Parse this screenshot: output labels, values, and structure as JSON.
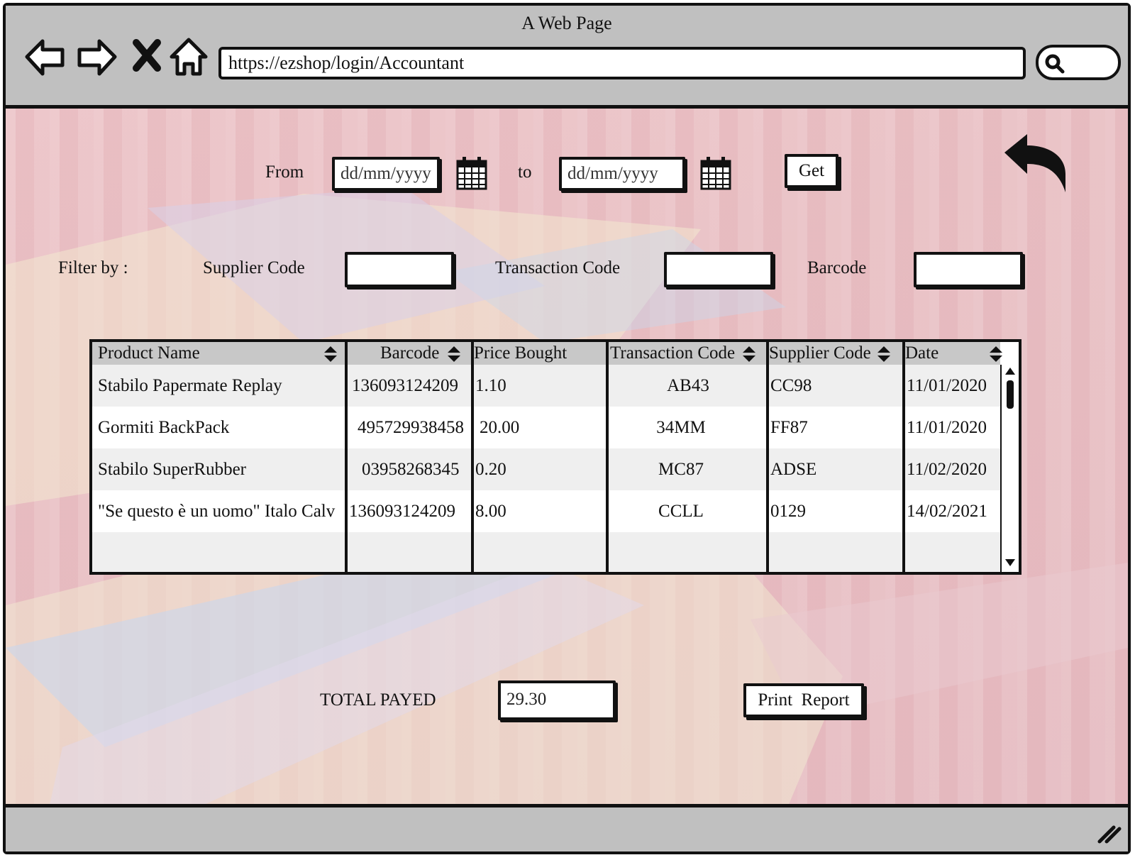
{
  "browser": {
    "window_title": "A Web Page",
    "url": "https://ezshop/login/Accountant",
    "nav_icons": [
      "back-arrow-icon",
      "forward-arrow-icon",
      "close-x-icon",
      "home-icon"
    ],
    "search_icon": "search-icon"
  },
  "date_range": {
    "from_label": "From",
    "from_placeholder": "dd/mm/yyyy",
    "to_label": "to",
    "to_placeholder": "dd/mm/yyyy",
    "get_label": "Get"
  },
  "filters": {
    "filter_by_label": "Filter by :",
    "supplier_code_label": "Supplier Code",
    "supplier_code_value": "",
    "transaction_code_label": "Transaction Code",
    "transaction_code_value": "",
    "barcode_label": "Barcode",
    "barcode_value": ""
  },
  "table": {
    "columns": [
      "Product Name",
      "Barcode",
      "Price Bought",
      "Transaction Code",
      "Supplier Code",
      "Date"
    ],
    "sortable": [
      true,
      true,
      false,
      true,
      true,
      true
    ],
    "rows": [
      [
        "Stabilo Papermate Replay",
        "136093124209",
        "1.10",
        "AB43",
        "CC98",
        "11/01/2020"
      ],
      [
        "Gormiti BackPack",
        "495729938458",
        "20.00",
        "34MM",
        "FF87",
        "11/01/2020"
      ],
      [
        "Stabilo SuperRubber",
        "03958268345",
        "0.20",
        "MC87",
        "ADSE",
        "11/02/2020"
      ],
      [
        "\"Se questo è un uomo\" Italo Calv",
        "136093124209",
        "8.00",
        "CCLL",
        "0129",
        "14/02/2021"
      ]
    ]
  },
  "summary": {
    "total_label": "TOTAL PAYED",
    "total_value": "29.30",
    "print_label": "Print  Report"
  },
  "colors": {
    "chrome": "#c0c0c0",
    "background": "#ecc4c8",
    "table_header": "#c8c8c8",
    "row_alt": "#efefef"
  }
}
